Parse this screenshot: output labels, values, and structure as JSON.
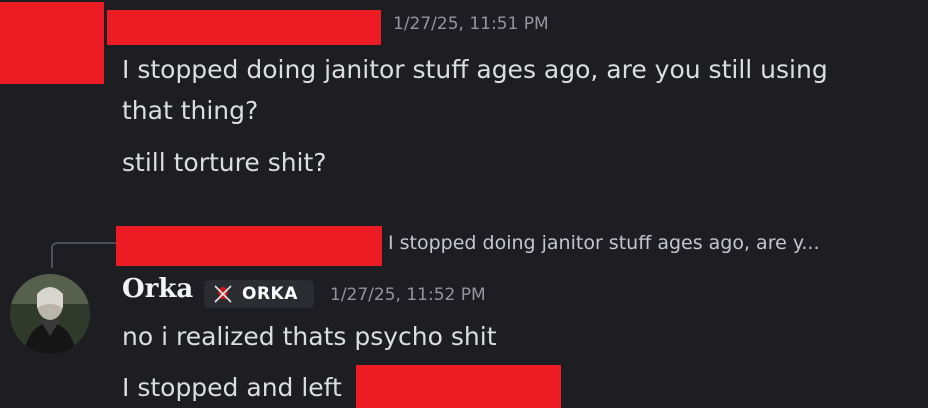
{
  "colors": {
    "background": "#1d1d22",
    "redaction": "#ed1c24",
    "text": "#dbdee1",
    "muted": "#94959c"
  },
  "first_message": {
    "timestamp": "1/27/25, 11:51 PM",
    "lines": [
      "I stopped doing janitor stuff ages ago, are you still using",
      "that thing?",
      "still torture shit?"
    ]
  },
  "reply": {
    "quoted_text": "I stopped doing janitor stuff ages ago, are y..."
  },
  "second_message": {
    "username": "Orka",
    "tag_label": "ORKA",
    "tag_icon": "skull-crossbones-icon",
    "timestamp": "1/27/25, 11:52 PM",
    "lines": [
      "no i realized thats psycho shit",
      "I stopped and left"
    ]
  }
}
